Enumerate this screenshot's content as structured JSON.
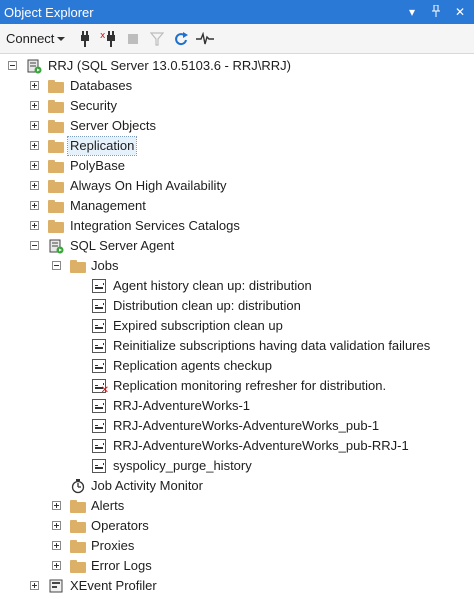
{
  "window": {
    "title": "Object Explorer"
  },
  "titlebar_icons": [
    "dropdown-arrow-icon",
    "pin-icon",
    "close-icon"
  ],
  "toolbar": {
    "connect_label": "Connect",
    "buttons": [
      "connect-plug-icon",
      "disconnect-icon",
      "stop-icon",
      "filter-icon",
      "refresh-icon",
      "activity-monitor-icon"
    ]
  },
  "tree": {
    "server": "RRJ (SQL Server 13.0.5103.6 - RRJ\\RRJ)",
    "server_children": [
      "Databases",
      "Security",
      "Server Objects",
      "Replication",
      "PolyBase",
      "Always On High Availability",
      "Management",
      "Integration Services Catalogs",
      "SQL Server Agent"
    ],
    "jobs_folder": "Jobs",
    "jobs": [
      "Agent history clean up: distribution",
      "Distribution clean up: distribution",
      "Expired subscription clean up",
      "Reinitialize subscriptions having data validation failures",
      "Replication agents checkup",
      "Replication monitoring refresher for distribution.",
      "RRJ-AdventureWorks-1",
      "RRJ-AdventureWorks-AdventureWorks_pub-1",
      "RRJ-AdventureWorks-AdventureWorks_pub-RRJ-1",
      "syspolicy_purge_history"
    ],
    "job_activity_monitor": "Job Activity Monitor",
    "agent_children": [
      "Alerts",
      "Operators",
      "Proxies",
      "Error Logs"
    ],
    "xevent_profiler": "XEvent Profiler"
  }
}
